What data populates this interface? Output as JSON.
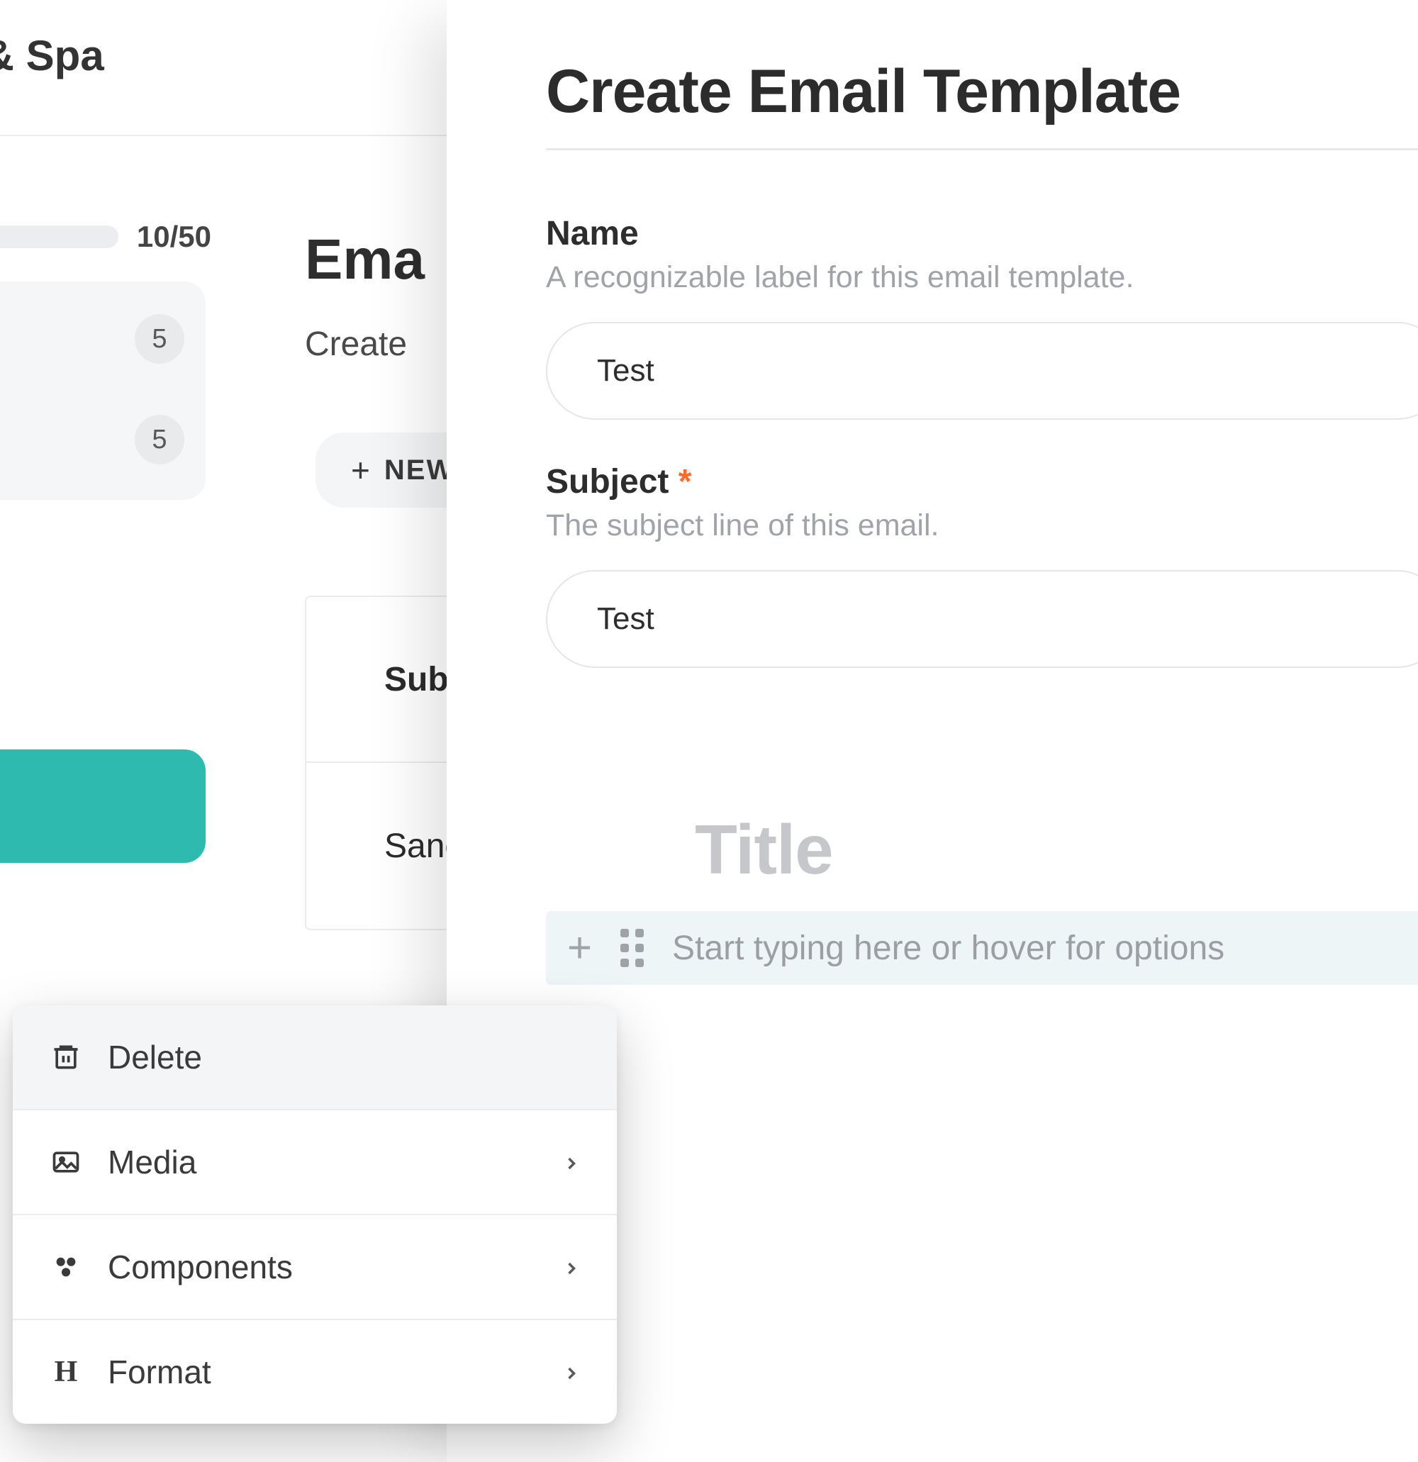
{
  "sidebar": {
    "org_fragment": "ort & Spa",
    "progress_label": "10/50",
    "badges": [
      "5",
      "5"
    ]
  },
  "background_page": {
    "title_fragment": "Ema",
    "subtitle_fragment": "Create",
    "new_button_fragment": "NEW",
    "table": {
      "header0_fragment": "Sub",
      "row0_fragment": "Sanc"
    }
  },
  "panel": {
    "title": "Create Email Template",
    "fields": {
      "name": {
        "label": "Name",
        "help": "A recognizable label for this email template.",
        "value": "Test"
      },
      "subject": {
        "label": "Subject",
        "required_mark": "*",
        "help": "The subject line of this email.",
        "value": "Test"
      }
    },
    "editor": {
      "title_placeholder": "Title",
      "line_placeholder": "Start typing here or hover for options"
    }
  },
  "context_menu": {
    "delete": "Delete",
    "media": "Media",
    "components": "Components",
    "format": "Format"
  }
}
